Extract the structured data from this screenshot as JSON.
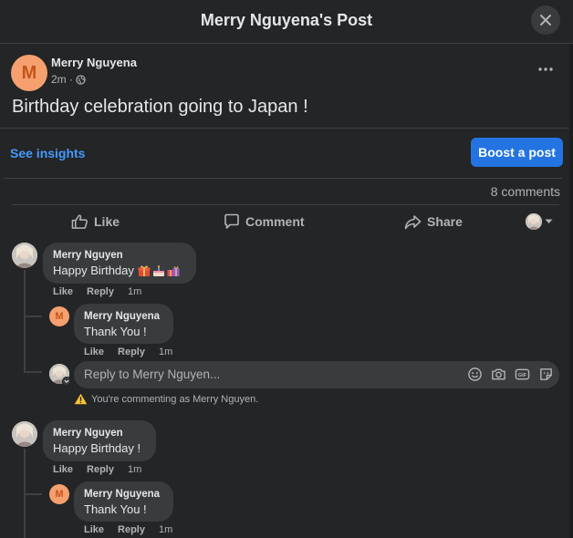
{
  "header": {
    "title": "Merry Nguyena's Post"
  },
  "post": {
    "avatar_letter": "M",
    "author": "Merry Nguyena",
    "time": "2m ·",
    "text": "Birthday celebration going to Japan !",
    "see_insights": "See insights",
    "boost_label": "Boost a post",
    "comments_count": "8 comments"
  },
  "actions": {
    "like": "Like",
    "comment": "Comment",
    "share": "Share"
  },
  "comments": [
    {
      "author": "Merry Nguyen",
      "text": "Happy Birthday",
      "emojis": [
        "gift-emoji",
        "cake-emoji",
        "gifts-emoji"
      ],
      "meta": {
        "like": "Like",
        "reply": "Reply",
        "time": "1m"
      },
      "reply": {
        "avatar_letter": "M",
        "author": "Merry Nguyena",
        "text": "Thank You !",
        "meta": {
          "like": "Like",
          "reply": "Reply",
          "time": "1m"
        }
      }
    },
    {
      "author": "Merry Nguyen",
      "text": "Happy Birthday !",
      "meta": {
        "like": "Like",
        "reply": "Reply",
        "time": "1m"
      },
      "reply": {
        "avatar_letter": "M",
        "author": "Merry Nguyena",
        "text": "Thank You !",
        "meta": {
          "like": "Like",
          "reply": "Reply",
          "time": "1m"
        }
      }
    }
  ],
  "reply_box": {
    "placeholder": "Reply to Merry Nguyen...",
    "icons": [
      "emoji-icon",
      "camera-icon",
      "gif-icon",
      "sticker-icon"
    ],
    "warning": "You're commenting as Merry Nguyen."
  },
  "colors": {
    "accent": "#2374e1",
    "link": "#4599ff",
    "avatar": "#f5a06e",
    "bubble": "#3a3b3c"
  }
}
